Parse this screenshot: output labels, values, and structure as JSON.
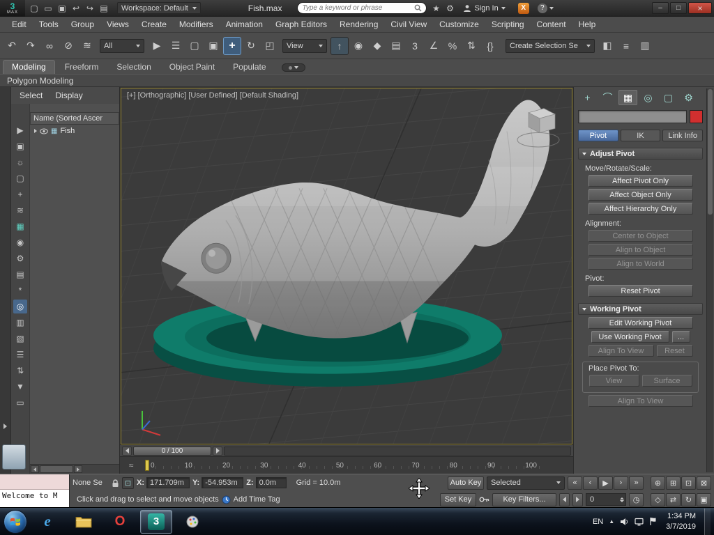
{
  "window": {
    "logo_text": "3",
    "logo_sub": "MAX",
    "workspace": "Workspace: Default",
    "title": "Fish.max",
    "search_placeholder": "Type a keyword or phrase",
    "sign_in": "Sign In",
    "exchange": "X",
    "help": "?",
    "controls": {
      "min": "–",
      "max": "□",
      "close": "×"
    }
  },
  "quick_access": [
    {
      "name": "new-file-icon",
      "glyph": "▢"
    },
    {
      "name": "open-file-icon",
      "glyph": "▭"
    },
    {
      "name": "save-file-icon",
      "glyph": "▣"
    },
    {
      "name": "undo-history-icon",
      "glyph": "↩"
    },
    {
      "name": "redo-history-icon",
      "glyph": "↪"
    },
    {
      "name": "project-folder-icon",
      "glyph": "▤"
    }
  ],
  "titlebar_icons": [
    {
      "name": "favorites-icon",
      "glyph": "★"
    },
    {
      "name": "settings-icon",
      "glyph": "⚙"
    }
  ],
  "menu_bar": {
    "items": [
      {
        "label": "Edit"
      },
      {
        "label": "Tools"
      },
      {
        "label": "Group"
      },
      {
        "label": "Views"
      },
      {
        "label": "Create"
      },
      {
        "label": "Modifiers"
      },
      {
        "label": "Animation"
      },
      {
        "label": "Graph Editors"
      },
      {
        "label": "Rendering"
      },
      {
        "label": "Civil View"
      },
      {
        "label": "Customize"
      },
      {
        "label": "Scripting"
      },
      {
        "label": "Content"
      },
      {
        "label": "Help"
      }
    ]
  },
  "toolbar": {
    "filter_value": "All",
    "coord_value": "View",
    "selection_set_value": "Create Selection Se",
    "group1": [
      {
        "name": "undo-icon",
        "glyph": "↶"
      },
      {
        "name": "redo-icon",
        "glyph": "↷"
      },
      {
        "name": "select-and-link-icon",
        "glyph": "∞"
      },
      {
        "name": "unlink-selection-icon",
        "glyph": "⊘"
      },
      {
        "name": "bind-to-space-warp-icon",
        "glyph": "≋"
      }
    ],
    "group2": [
      {
        "name": "select-object-icon",
        "glyph": "▶"
      },
      {
        "name": "select-by-name-icon",
        "glyph": "☰"
      },
      {
        "name": "rectangular-selection-icon",
        "glyph": "▢"
      },
      {
        "name": "window-crossing-icon",
        "glyph": "▣"
      },
      {
        "name": "select-and-move-icon",
        "glyph": "+",
        "state": "active"
      },
      {
        "name": "select-and-rotate-icon",
        "glyph": "↻"
      },
      {
        "name": "select-and-scale-icon",
        "glyph": "◰"
      }
    ],
    "group3": [
      {
        "name": "use-selection-center-icon",
        "glyph": "↑",
        "state": "boxed"
      },
      {
        "name": "use-pivot-point-icon",
        "glyph": "◉"
      },
      {
        "name": "select-and-manipulate-icon",
        "glyph": "◆"
      },
      {
        "name": "keyboard-override-icon",
        "glyph": "▤"
      },
      {
        "name": "snaps-toggle-icon",
        "glyph": "3"
      },
      {
        "name": "angle-snap-icon",
        "glyph": "∠"
      },
      {
        "name": "percent-snap-icon",
        "glyph": "%"
      },
      {
        "name": "spinner-snap-icon",
        "glyph": "⇅"
      },
      {
        "name": "named-selection-sets-icon",
        "glyph": "{}"
      }
    ],
    "group4": [
      {
        "name": "mirror-icon",
        "glyph": "◧"
      },
      {
        "name": "align-icon",
        "glyph": "≡"
      },
      {
        "name": "scene-explorer-toggle-icon",
        "glyph": "▥"
      }
    ]
  },
  "ribbon": {
    "tabs": [
      {
        "label": "Modeling",
        "state": "active"
      },
      {
        "label": "Freeform"
      },
      {
        "label": "Selection"
      },
      {
        "label": "Object Paint"
      },
      {
        "label": "Populate"
      }
    ],
    "panel_title": "Polygon Modeling"
  },
  "scene_explorer": {
    "menus": [
      {
        "label": "Select"
      },
      {
        "label": "Display"
      }
    ],
    "column_header": "Name (Sorted Ascer",
    "tools": [
      {
        "name": "se-select-icon",
        "glyph": "▶"
      },
      {
        "name": "se-display-geometry-icon",
        "glyph": "▣"
      },
      {
        "name": "se-display-lights-icon",
        "glyph": "☼"
      },
      {
        "name": "se-display-cameras-icon",
        "glyph": "▢"
      },
      {
        "name": "se-display-helpers-icon",
        "glyph": "+"
      },
      {
        "name": "se-display-warps-icon",
        "glyph": "≋"
      },
      {
        "name": "se-display-grid-icon",
        "glyph": "▦",
        "state": "teal"
      },
      {
        "name": "se-display-spheres-icon",
        "glyph": "◉"
      },
      {
        "name": "se-display-bones-icon",
        "glyph": "⚙"
      },
      {
        "name": "se-display-containers-icon",
        "glyph": "▤"
      },
      {
        "name": "se-display-frozen-icon",
        "glyph": "*"
      },
      {
        "name": "se-display-hidden-icon",
        "glyph": "◎",
        "state": "active"
      },
      {
        "name": "se-properties-icon",
        "glyph": "▥"
      },
      {
        "name": "se-locked-icon",
        "glyph": "▧"
      },
      {
        "name": "se-list-view-icon",
        "glyph": "☰"
      },
      {
        "name": "se-sync-icon",
        "glyph": "⇅"
      },
      {
        "name": "se-filter-icon",
        "glyph": "▼"
      },
      {
        "name": "se-folder-icon",
        "glyph": "▭"
      }
    ],
    "rows": [
      {
        "label": "Fish",
        "icon": "▦"
      }
    ]
  },
  "viewport": {
    "header": "[+] [Orthographic] [User Defined] [Default Shading]"
  },
  "timeline": {
    "slider_label": "0 / 100",
    "curve_icon": "≈",
    "ticks": [
      {
        "label": "0"
      },
      {
        "label": "10"
      },
      {
        "label": "20"
      },
      {
        "label": "30"
      },
      {
        "label": "40"
      },
      {
        "label": "50"
      },
      {
        "label": "60"
      },
      {
        "label": "70"
      },
      {
        "label": "80"
      },
      {
        "label": "90"
      },
      {
        "label": "100"
      }
    ]
  },
  "command_panel": {
    "mode_tabs": [
      {
        "name": "create-panel-icon",
        "glyph": "+"
      },
      {
        "name": "modify-panel-icon",
        "glyph": "⌒"
      },
      {
        "name": "hierarchy-panel-icon",
        "glyph": "▦",
        "state": "active"
      },
      {
        "name": "motion-panel-icon",
        "glyph": "◎"
      },
      {
        "name": "display-panel-icon",
        "glyph": "▢"
      },
      {
        "name": "utilities-panel-icon",
        "glyph": "⚙"
      }
    ],
    "object_color": "#d12f2f",
    "tabs": [
      {
        "label": "Pivot",
        "state": "active"
      },
      {
        "label": "IK"
      },
      {
        "label": "Link Info"
      }
    ],
    "adjust_pivot": {
      "title": "Adjust Pivot",
      "section_label": "Move/Rotate/Scale:",
      "buttons": [
        {
          "label": "Affect Pivot Only",
          "name": "affect-pivot-only-button"
        },
        {
          "label": "Affect Object Only",
          "name": "affect-object-only-button"
        },
        {
          "label": "Affect Hierarchy Only",
          "name": "affect-hierarchy-only-button"
        }
      ],
      "alignment_label": "Alignment:",
      "alignment_buttons": [
        {
          "label": "Center to Object",
          "name": "center-to-object-button",
          "state": "disabled"
        },
        {
          "label": "Align to Object",
          "name": "align-to-object-button",
          "state": "disabled"
        },
        {
          "label": "Align to World",
          "name": "align-to-world-button",
          "state": "disabled"
        }
      ],
      "pivot_label": "Pivot:",
      "reset_label": "Reset Pivot"
    },
    "working_pivot": {
      "title": "Working Pivot",
      "edit_label": "Edit Working Pivot",
      "use_label": "Use Working Pivot",
      "more_label": "...",
      "align_view_label": "Align To View",
      "reset_label": "Reset",
      "place_label": "Place Pivot To:",
      "view_label": "View",
      "surface_label": "Surface",
      "clipped_label": "Align To View"
    }
  },
  "status_bar": {
    "listener_text": "Welcome to M",
    "selection_text": "None Se",
    "abs_glyph": "⊡",
    "x_label": "X:",
    "x_value": "171.709m",
    "y_label": "Y:",
    "y_value": "-54.953m",
    "z_label": "Z:",
    "z_value": "0.0m",
    "grid_text": "Grid = 10.0m",
    "prompt_text": "Click and drag to select and move objects",
    "time_tag_text": "Add Time Tag",
    "auto_key_label": "Auto Key",
    "set_key_label": "Set Key",
    "selected_value": "Selected",
    "key_filters_label": "Key Filters...",
    "frame_value": "0",
    "time_config_glyph": "◷",
    "playback": [
      {
        "name": "go-to-start-button",
        "glyph": "«"
      },
      {
        "name": "previous-frame-button",
        "glyph": "‹"
      },
      {
        "name": "play-animation-button",
        "glyph": "▶"
      },
      {
        "name": "next-frame-button",
        "glyph": "›"
      },
      {
        "name": "go-to-end-button",
        "glyph": "»"
      }
    ],
    "nav_row1": [
      {
        "name": "zoom-icon",
        "glyph": "⊕"
      },
      {
        "name": "zoom-all-icon",
        "glyph": "⊞"
      },
      {
        "name": "zoom-extents-icon",
        "glyph": "⊡"
      },
      {
        "name": "zoom-extents-all-icon",
        "glyph": "⊠"
      }
    ],
    "nav_row2": [
      {
        "name": "fov-icon",
        "glyph": "◇"
      },
      {
        "name": "pan-icon",
        "glyph": "⇄"
      },
      {
        "name": "orbit-icon",
        "glyph": "↻"
      },
      {
        "name": "maximize-viewport-icon",
        "glyph": "▣"
      }
    ]
  },
  "taskbar": {
    "ie_glyph": "e",
    "opera_glyph": "O",
    "max_glyph": "3",
    "language": "EN",
    "tray_arrow": "▲",
    "time": "1:34 PM",
    "date": "3/7/2019"
  }
}
